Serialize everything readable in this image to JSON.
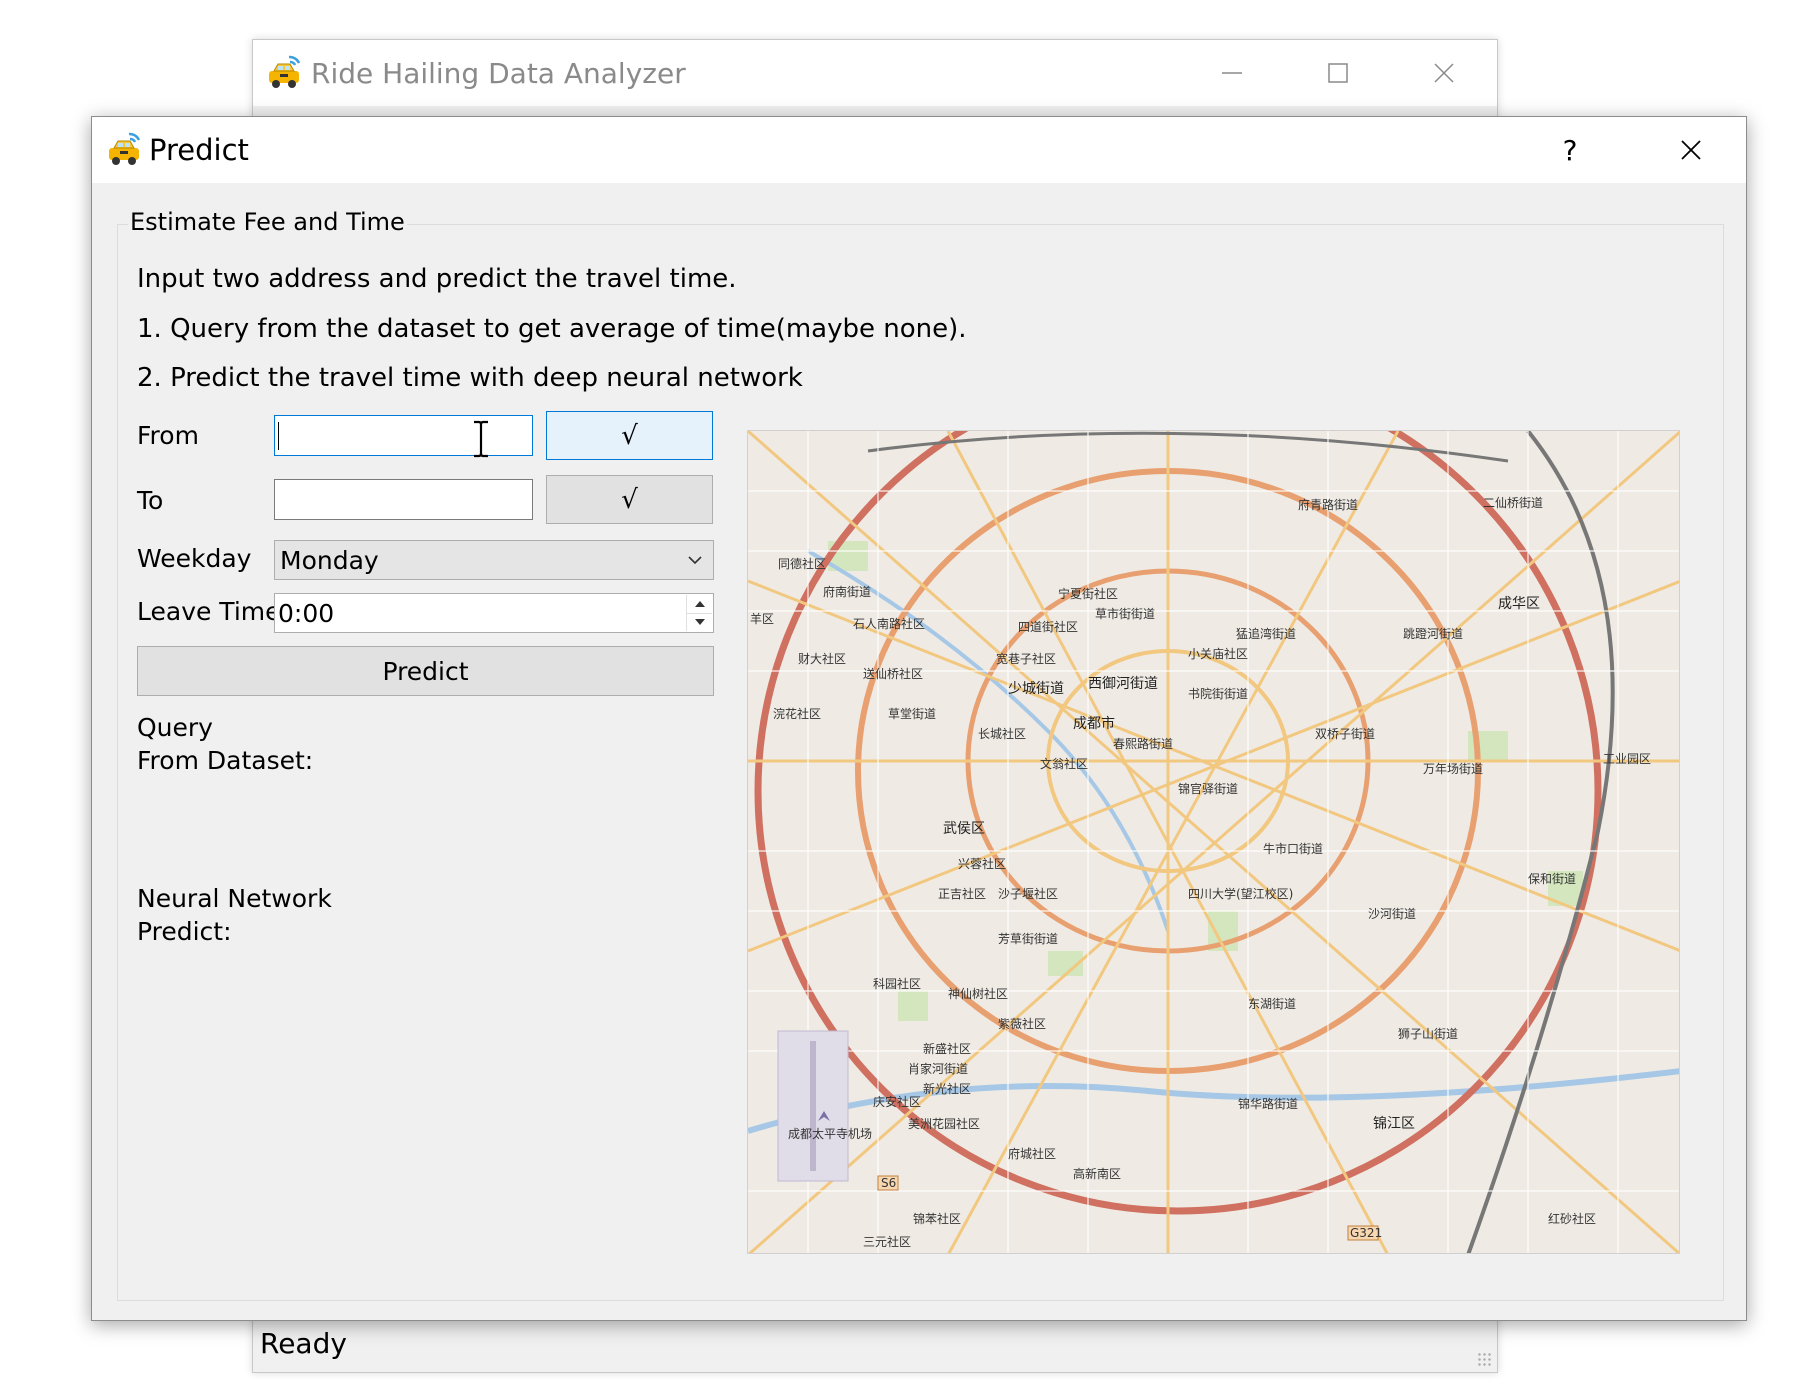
{
  "main_window": {
    "title": "Ride Hailing Data Analyzer",
    "status": "Ready",
    "controls": [
      "minimize-icon",
      "maximize-icon",
      "close-icon"
    ]
  },
  "dialog": {
    "title": "Predict",
    "help_label": "?",
    "close_label": "✕",
    "group_title": "Estimate Fee and Time",
    "description": [
      "Input two address and predict the travel time.",
      "1. Query from the dataset to get average of time(maybe none).",
      "2. Predict the travel time with deep neural network"
    ],
    "from": {
      "label": "From",
      "value": "",
      "confirm_label": "√"
    },
    "to": {
      "label": "To",
      "value": "",
      "confirm_label": "√"
    },
    "weekday": {
      "label": "Weekday",
      "selected": "Monday"
    },
    "leave_time": {
      "label": "Leave Time",
      "value": "0:00"
    },
    "predict_label": "Predict",
    "query_label_1": "Query",
    "query_label_2": "From Dataset:",
    "nn_label_1": "Neural Network",
    "nn_label_2": "Predict:"
  },
  "map": {
    "labels": [
      "府青路街道",
      "二仙桥街道",
      "成华区",
      "跳蹬河街道",
      "猛追湾街道",
      "草市街街道",
      "府南街道",
      "宁夏街社区",
      "小关庙社区",
      "四道街社区",
      "石人南路社区",
      "财大社区",
      "送仙桥社区",
      "宽巷子社区",
      "少城街道",
      "西御河街道",
      "书院街街道",
      "羊区",
      "草堂街道",
      "成都市",
      "春熙路街道",
      "双桥子街道",
      "万年场街道",
      "工业园区",
      "长城社区",
      "文翁社区",
      "锦官驿街道",
      "浣花社区",
      "武侯区",
      "牛市口街道",
      "兴蓉社区",
      "四川大学(望江校区)",
      "保和街道",
      "正吉社区",
      "沙子堰社区",
      "沙河街道",
      "芳草街街道",
      "东湖街道",
      "狮子山街道",
      "科园社区",
      "神仙树社区",
      "紫薇社区",
      "新盛社区",
      "肖家河街道",
      "新光社区",
      "庆安社区",
      "锦华路街道",
      "锦江区",
      "美洲花园社区",
      "府城社区",
      "高新南区",
      "成都太平寺机场",
      "锦苯社区",
      "三元社区",
      "红砂社区",
      "同德社区"
    ],
    "route_labels": [
      "S6",
      "G321"
    ]
  }
}
